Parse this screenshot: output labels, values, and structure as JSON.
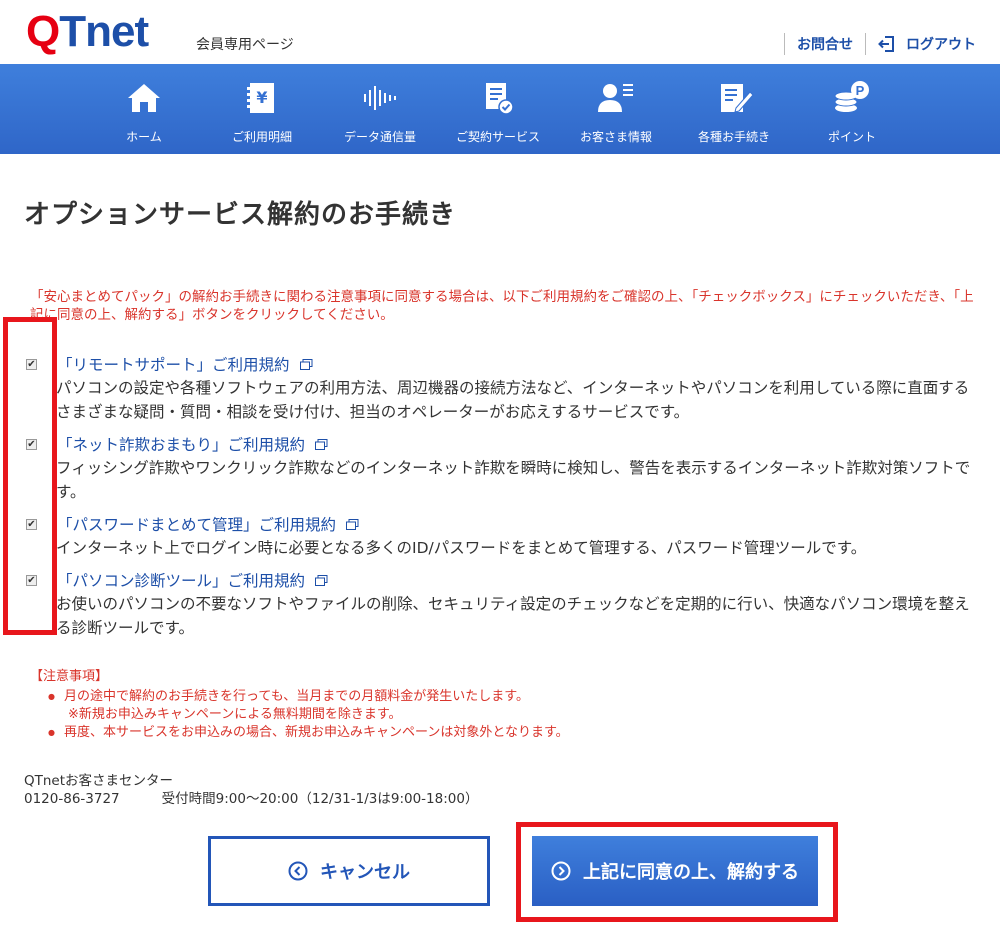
{
  "header": {
    "logo_q": "Q",
    "logo_rest": "Tnet",
    "member_page": "会員専用ページ",
    "inquiry": "お問合せ",
    "logout": "ログアウト"
  },
  "nav": {
    "items": [
      {
        "label": "ホーム",
        "icon": "home-icon"
      },
      {
        "label": "ご利用明細",
        "icon": "statement-icon"
      },
      {
        "label": "データ通信量",
        "icon": "data-usage-icon"
      },
      {
        "label": "ご契約サービス",
        "icon": "contract-icon"
      },
      {
        "label": "お客さま情報",
        "icon": "customer-icon"
      },
      {
        "label": "各種お手続き",
        "icon": "procedure-icon"
      },
      {
        "label": "ポイント",
        "icon": "point-icon"
      }
    ]
  },
  "main": {
    "title": "オプションサービス解約のお手続き",
    "intro": "「安心まとめてパック」の解約お手続きに関わる注意事項に同意する場合は、以下ご利用規約をご確認の上、「チェックボックス」にチェックいただき、「上記に同意の上、解約する」ボタンをクリックしてください。",
    "terms": [
      {
        "link": "「リモートサポート」ご利用規約",
        "checked": true,
        "desc": "パソコンの設定や各種ソフトウェアの利用方法、周辺機器の接続方法など、インターネットやパソコンを利用している際に直面するさまざまな疑問・質問・相談を受け付け、担当のオペレーターがお応えするサービスです。"
      },
      {
        "link": "「ネット詐欺おまもり」ご利用規約",
        "checked": true,
        "desc": "フィッシング詐欺やワンクリック詐欺などのインターネット詐欺を瞬時に検知し、警告を表示するインターネット詐欺対策ソフトです。"
      },
      {
        "link": "「パスワードまとめて管理」ご利用規約",
        "checked": true,
        "desc": "インターネット上でログイン時に必要となる多くのID/パスワードをまとめて管理する、パスワード管理ツールです。"
      },
      {
        "link": "「パソコン診断ツール」ご利用規約",
        "checked": true,
        "desc": "お使いのパソコンの不要なソフトやファイルの削除、セキュリティ設定のチェックなどを定期的に行い、快適なパソコン環境を整える診断ツールです。"
      }
    ],
    "caution": {
      "title": "【注意事項】",
      "item1": "月の途中で解約のお手続きを行っても、当月までの月額料金が発生いたします。",
      "item1_sub": "※新規お申込みキャンペーンによる無料期間を除きます。",
      "item2": "再度、本サービスをお申込みの場合、新規お申込みキャンペーンは対象外となります。"
    },
    "center": {
      "name": "QTnetお客さまセンター",
      "phone": "0120-86-3727",
      "hours": "受付時間9:00～20:00（12/31-1/3は9:00-18:00）"
    }
  },
  "buttons": {
    "cancel": "キャンセル",
    "agree": "上記に同意の上、解約する"
  },
  "colors": {
    "brand_blue": "#2f66c8",
    "brand_red": "#e60012",
    "notice_red": "#d9342b",
    "highlight_red": "#e8161c"
  }
}
